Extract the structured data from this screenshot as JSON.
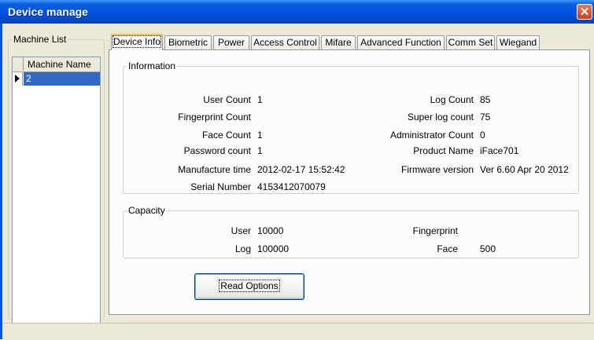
{
  "window": {
    "title": "Device manage",
    "close_label": "✕"
  },
  "machine_list": {
    "legend": "Machine List",
    "column_header": "Machine Name",
    "rows": [
      {
        "name": "2",
        "selected": true
      }
    ]
  },
  "tabs": [
    {
      "label": "Device Info",
      "active": true
    },
    {
      "label": "Biometric"
    },
    {
      "label": "Power"
    },
    {
      "label": "Access Control"
    },
    {
      "label": "Mifare"
    },
    {
      "label": "Advanced Function"
    },
    {
      "label": "Comm Set"
    },
    {
      "label": "Wiegand"
    }
  ],
  "information": {
    "legend": "Information",
    "user_count": {
      "label": "User Count",
      "value": "1"
    },
    "fingerprint_count": {
      "label": "Fingerprint Count",
      "value": ""
    },
    "face_count": {
      "label": "Face Count",
      "value": "1"
    },
    "password_count": {
      "label": "Password count",
      "value": "1"
    },
    "manufacture_time": {
      "label": "Manufacture time",
      "value": "2012-02-17 15:52:42"
    },
    "serial_number": {
      "label": "Serial Number",
      "value": "4153412070079"
    },
    "log_count": {
      "label": "Log Count",
      "value": "85"
    },
    "super_log_count": {
      "label": "Super log count",
      "value": "75"
    },
    "administrator_count": {
      "label": "Administrator Count",
      "value": "0"
    },
    "product_name": {
      "label": "Product Name",
      "value": "iFace701"
    },
    "firmware_version": {
      "label": "Firmware version",
      "value": "Ver 6.60 Apr 20 2012"
    }
  },
  "capacity": {
    "legend": "Capacity",
    "user": {
      "label": "User",
      "value": "10000"
    },
    "log": {
      "label": "Log",
      "value": "100000"
    },
    "fingerprint": {
      "label": "Fingerprint",
      "value": ""
    },
    "face": {
      "label": "Face",
      "value": "500"
    }
  },
  "read_options_label": "Read Options",
  "colors": {
    "titlebar": "#0054e3",
    "selection": "#316ac5",
    "dialog_bg": "#ece9d8",
    "panel_bg": "#fcfcfe"
  }
}
